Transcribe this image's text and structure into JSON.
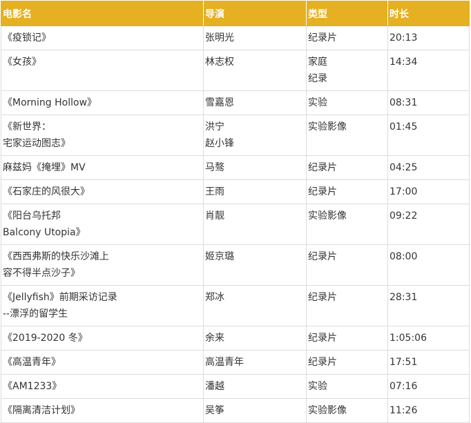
{
  "table": {
    "headers": [
      "电影名",
      "导演",
      "类型",
      "时长"
    ],
    "rows": [
      {
        "title": "《疫锁记》",
        "director": "张明光",
        "genre": "纪录片",
        "duration": "20:13"
      },
      {
        "title": "《女孩》",
        "director": "林志权",
        "genre": "家庭\n纪录",
        "duration": "14:34"
      },
      {
        "title": "《Morning Hollow》",
        "director": "雪嘉恩",
        "genre": "实验",
        "duration": "08:31"
      },
      {
        "title": "《新世界：\n宅家运动图志》",
        "director": "洪宁\n赵小锋",
        "genre": "实验影像",
        "duration": "01:45"
      },
      {
        "title": "麻兹妈《掩埋》MV",
        "director": "马骜",
        "genre": "纪录片",
        "duration": "04:25"
      },
      {
        "title": "《石家庄的风很大》",
        "director": "王雨",
        "genre": "纪录片",
        "duration": "17:00"
      },
      {
        "title": "《阳台乌托邦\nBalcony Utopia》",
        "director": "肖靓",
        "genre": "实验影像",
        "duration": "09:22"
      },
      {
        "title": "《西西弗斯的快乐沙滩上\n容不得半点沙子》",
        "director": "姬京璐",
        "genre": "纪录片",
        "duration": "08:00"
      },
      {
        "title": "《Jellyfish》前期采访记录\n--漂浮的留学生",
        "director": "郑冰",
        "genre": "纪录片",
        "duration": "28:31"
      },
      {
        "title": "《2019-2020 冬》",
        "director": "余来",
        "genre": "纪录片",
        "duration": "1:05:06"
      },
      {
        "title": "《高温青年》",
        "director": "高温青年",
        "genre": "纪录片",
        "duration": "17:51"
      },
      {
        "title": "《AM1233》",
        "director": "潘越",
        "genre": "实验",
        "duration": "07:16"
      },
      {
        "title": "《隔离清洁计划》",
        "director": "吴筝",
        "genre": "实验影像",
        "duration": "11:26"
      }
    ]
  }
}
